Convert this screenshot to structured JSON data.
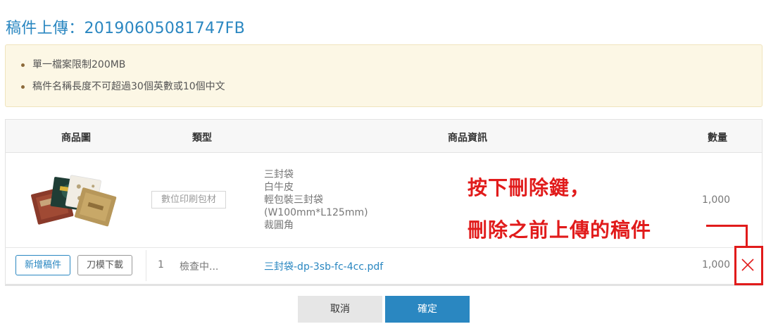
{
  "page": {
    "title": "稿件上傳：20190605081747FB"
  },
  "notice": {
    "items": [
      "單一檔案限制200MB",
      "稿件名稱長度不可超過30個英數或10個中文"
    ]
  },
  "table": {
    "headers": {
      "image": "商品圖",
      "type": "類型",
      "info": "商品資訊",
      "quantity": "數量"
    },
    "product": {
      "type_badge": "數位印刷包材",
      "info_lines": [
        "三封袋",
        "白牛皮",
        "輕包裝三封袋",
        "(W100mm*L125mm)",
        "裁圓角"
      ],
      "quantity": "1,000"
    },
    "file_row": {
      "add_button": "新增稿件",
      "download_button": "刀模下載",
      "index": "1",
      "status": "檢查中...",
      "filename": "三封袋-dp-3sb-fc-4cc.pdf",
      "quantity": "1,000",
      "delete_icon": "close-icon"
    }
  },
  "annotation": {
    "line1": "按下刪除鍵，",
    "line2": "刪除之前上傳的稿件",
    "color": "#e11b1b"
  },
  "footer": {
    "cancel_label": "取消",
    "confirm_label": "確定"
  },
  "colors": {
    "accent": "#2a87c1",
    "notice_bg": "#fcf7e5",
    "alert": "#e11b1b"
  }
}
